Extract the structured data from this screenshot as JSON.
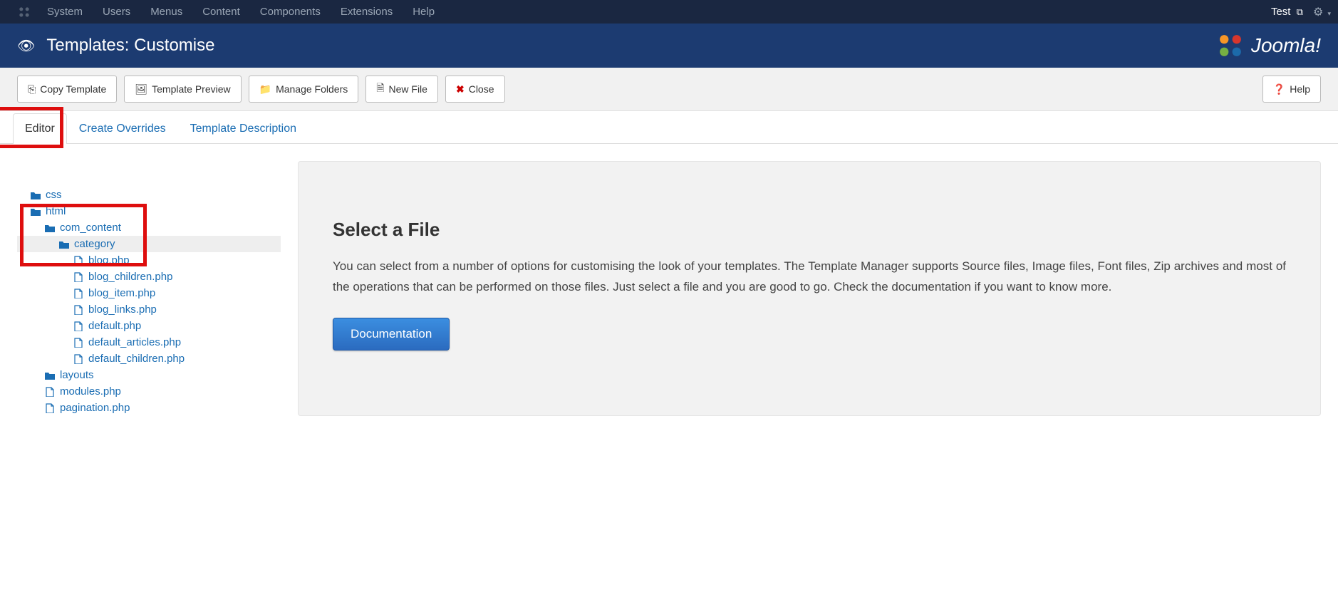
{
  "topmenu": {
    "items": [
      "System",
      "Users",
      "Menus",
      "Content",
      "Components",
      "Extensions",
      "Help"
    ],
    "site_name": "Test"
  },
  "titlebar": {
    "title": "Templates: Customise",
    "brand": "Joomla!"
  },
  "toolbar": {
    "copy_template": "Copy Template",
    "template_preview": "Template Preview",
    "manage_folders": "Manage Folders",
    "new_file": "New File",
    "close": "Close",
    "help": "Help"
  },
  "tabs": {
    "editor": "Editor",
    "create_overrides": "Create Overrides",
    "template_description": "Template Description"
  },
  "tree": {
    "css": "css",
    "html": "html",
    "com_content": "com_content",
    "category": "category",
    "files": {
      "blog": "blog.php",
      "blog_children": "blog_children.php",
      "blog_item": "blog_item.php",
      "blog_links": "blog_links.php",
      "default": "default.php",
      "default_articles": "default_articles.php",
      "default_children": "default_children.php"
    },
    "layouts": "layouts",
    "modules": "modules.php",
    "pagination": "pagination.php"
  },
  "panel": {
    "heading": "Select a File",
    "body": "You can select from a number of options for customising the look of your templates. The Template Manager supports Source files, Image files, Font files, Zip archives and most of the operations that can be performed on those files. Just select a file and you are good to go. Check the documentation if you want to know more.",
    "doc_btn": "Documentation"
  }
}
